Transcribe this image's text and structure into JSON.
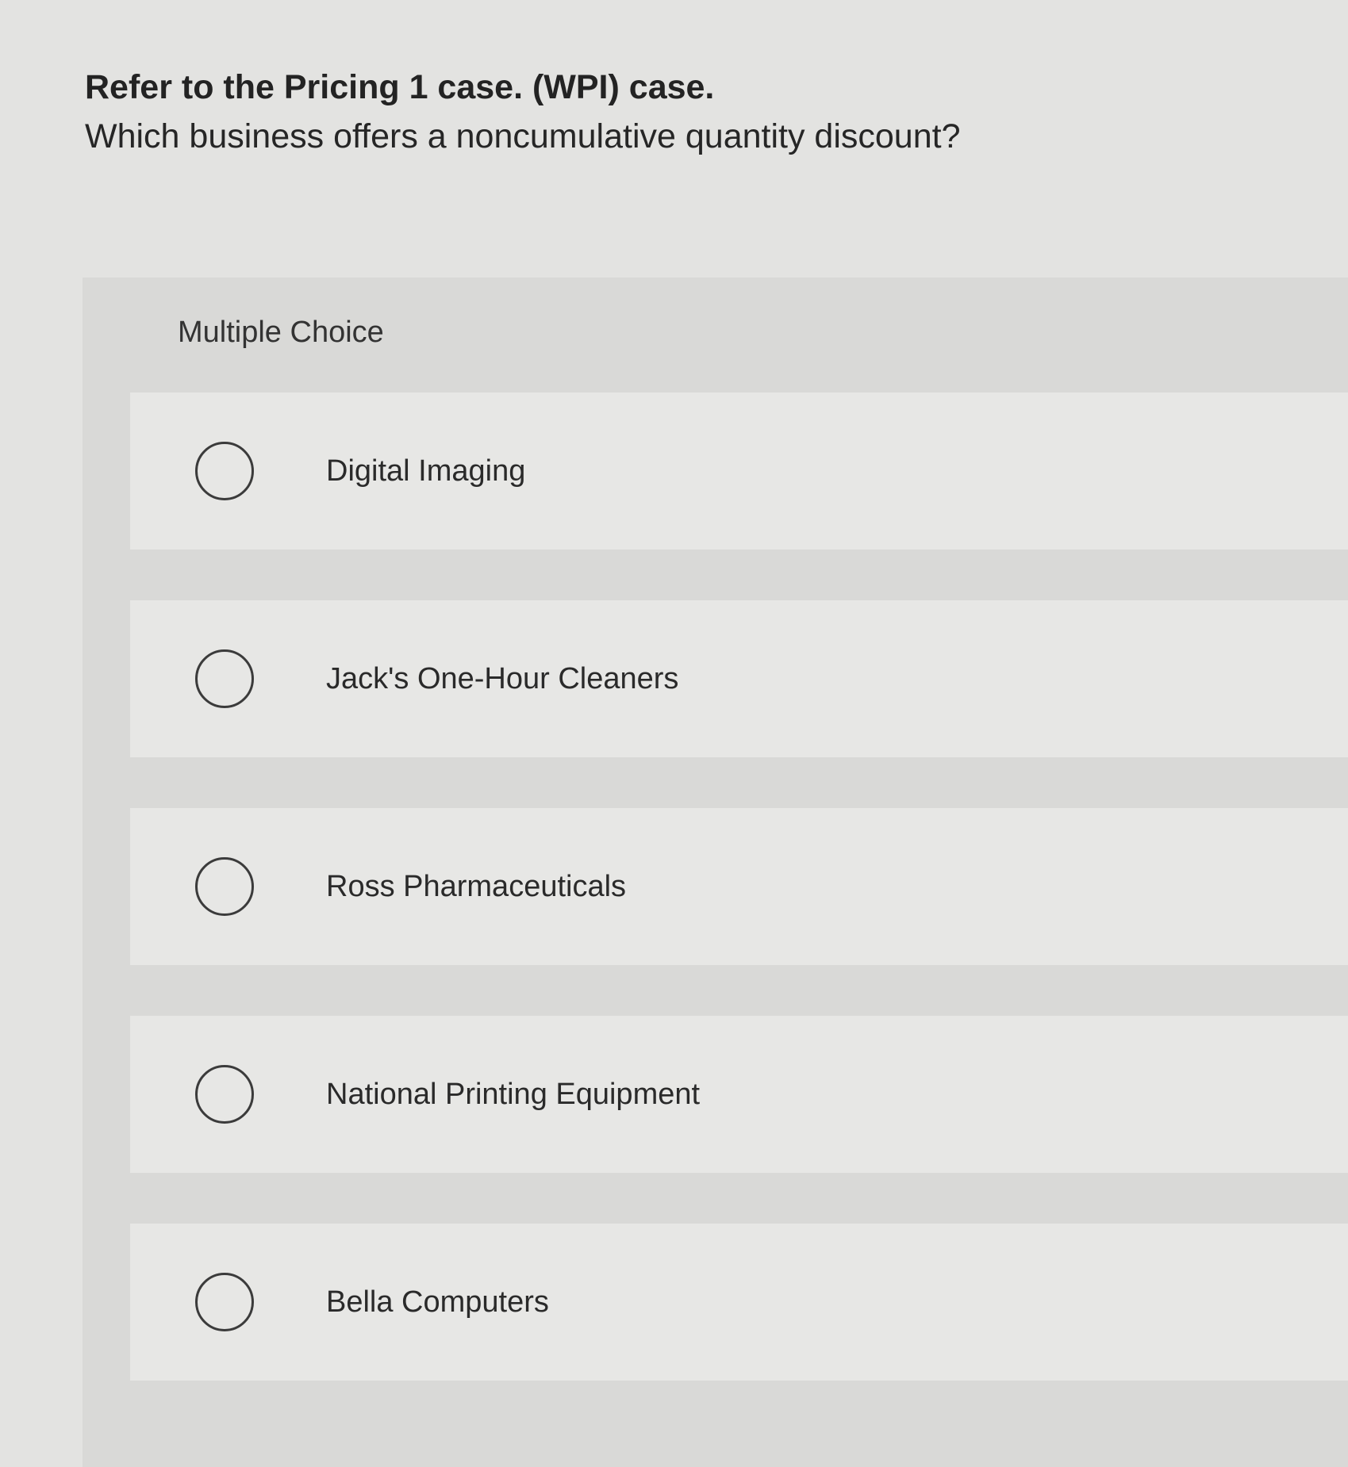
{
  "question": {
    "title": "Refer to the Pricing 1 case. (WPI) case.",
    "text": "Which business offers a noncumulative quantity discount?"
  },
  "multiple_choice": {
    "header": "Multiple Choice",
    "options": [
      {
        "label": "Digital Imaging",
        "selected": false
      },
      {
        "label": "Jack's One-Hour Cleaners",
        "selected": false
      },
      {
        "label": "Ross Pharmaceuticals",
        "selected": false
      },
      {
        "label": "National Printing Equipment",
        "selected": false
      },
      {
        "label": "Bella Computers",
        "selected": false
      }
    ]
  }
}
